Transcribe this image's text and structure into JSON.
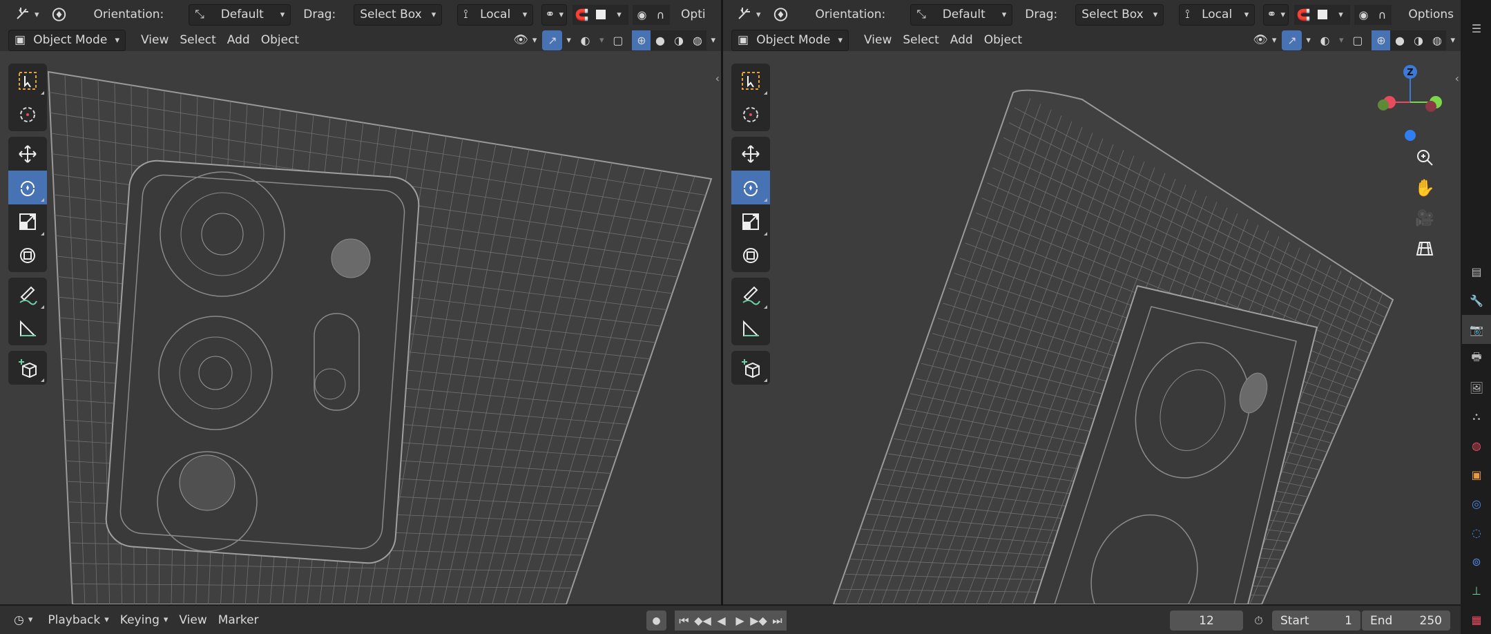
{
  "left_viewport": {
    "header": {
      "orientation_label": "Orientation:",
      "orientation_value": "Default",
      "drag_label": "Drag:",
      "drag_value": "Select Box",
      "pivot_value": "Local",
      "options_label": "Opti",
      "mode_value": "Object Mode",
      "menus": [
        "View",
        "Select",
        "Add",
        "Object"
      ]
    }
  },
  "right_viewport": {
    "header": {
      "orientation_label": "Orientation:",
      "orientation_value": "Default",
      "drag_label": "Drag:",
      "drag_value": "Select Box",
      "pivot_value": "Local",
      "options_label": "Options",
      "mode_value": "Object Mode",
      "menus": [
        "View",
        "Select",
        "Add",
        "Object"
      ]
    },
    "gizmo": {
      "z_label": "Z",
      "x_color": "#e84a5f",
      "y_color": "#7bd64a",
      "z_color": "#3b7ad6"
    }
  },
  "toolbar": {
    "tools": [
      "select-box",
      "cursor",
      "move",
      "rotate",
      "scale",
      "transform",
      "annotate",
      "measure",
      "add-cube"
    ],
    "active_tool": "rotate"
  },
  "timeline": {
    "menus": [
      "Playback",
      "Keying",
      "View",
      "Marker"
    ],
    "current_frame": "12",
    "start_label": "Start",
    "start_value": "1",
    "end_label": "End",
    "end_value": "250"
  },
  "colors": {
    "accent": "#4772b3",
    "viewport_bg": "#3d3d3d",
    "header_bg": "#303030",
    "wire": "#8a8a8a"
  }
}
